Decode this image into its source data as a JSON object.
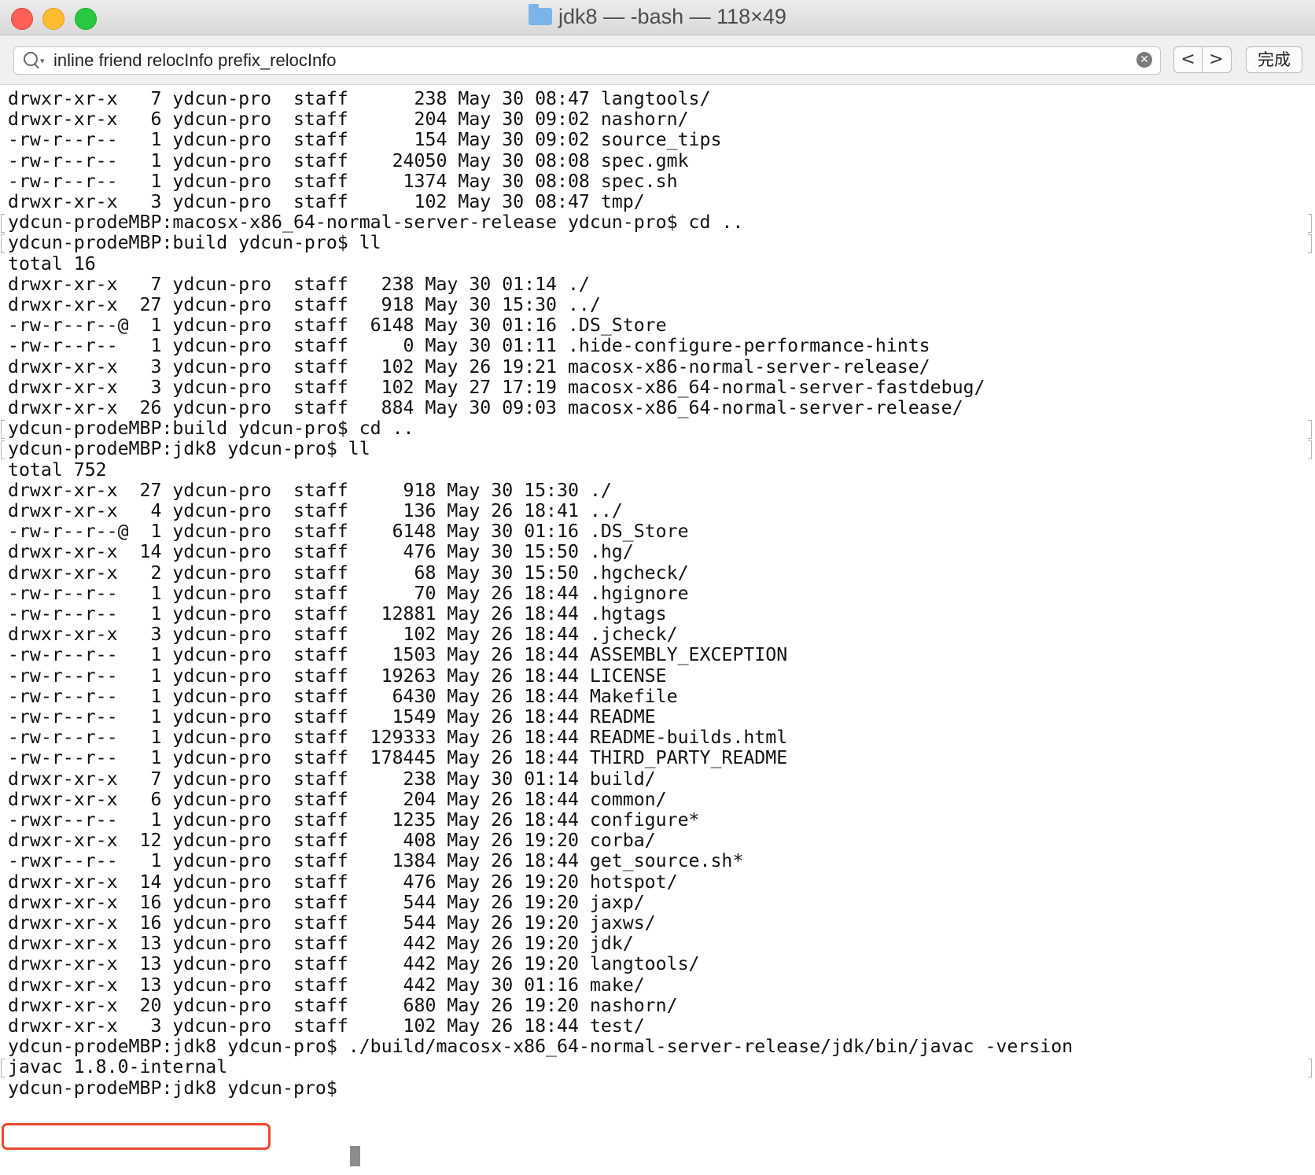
{
  "window": {
    "title": "jdk8 — -bash — 118×49",
    "folder_icon": "folder-icon",
    "buttons": [
      "close",
      "minimize",
      "zoom"
    ]
  },
  "find_bar": {
    "query": "inline friend relocInfo prefix_relocInfo",
    "prev_label": "<",
    "next_label": ">",
    "done_label": "完成"
  },
  "terminal": {
    "lines": [
      "drwxr-xr-x   7 ydcun-pro  staff      238 May 30 08:47 langtools/",
      "drwxr-xr-x   6 ydcun-pro  staff      204 May 30 09:02 nashorn/",
      "-rw-r--r--   1 ydcun-pro  staff      154 May 30 09:02 source_tips",
      "-rw-r--r--   1 ydcun-pro  staff    24050 May 30 08:08 spec.gmk",
      "-rw-r--r--   1 ydcun-pro  staff     1374 May 30 08:08 spec.sh",
      "drwxr-xr-x   3 ydcun-pro  staff      102 May 30 08:47 tmp/",
      "ydcun-prodeMBP:macosx-x86_64-normal-server-release ydcun-pro$ cd ..",
      "ydcun-prodeMBP:build ydcun-pro$ ll",
      "total 16",
      "drwxr-xr-x   7 ydcun-pro  staff   238 May 30 01:14 ./",
      "drwxr-xr-x  27 ydcun-pro  staff   918 May 30 15:30 ../",
      "-rw-r--r--@  1 ydcun-pro  staff  6148 May 30 01:16 .DS_Store",
      "-rw-r--r--   1 ydcun-pro  staff     0 May 30 01:11 .hide-configure-performance-hints",
      "drwxr-xr-x   3 ydcun-pro  staff   102 May 26 19:21 macosx-x86-normal-server-release/",
      "drwxr-xr-x   3 ydcun-pro  staff   102 May 27 17:19 macosx-x86_64-normal-server-fastdebug/",
      "drwxr-xr-x  26 ydcun-pro  staff   884 May 30 09:03 macosx-x86_64-normal-server-release/",
      "ydcun-prodeMBP:build ydcun-pro$ cd ..",
      "ydcun-prodeMBP:jdk8 ydcun-pro$ ll",
      "total 752",
      "drwxr-xr-x  27 ydcun-pro  staff     918 May 30 15:30 ./",
      "drwxr-xr-x   4 ydcun-pro  staff     136 May 26 18:41 ../",
      "-rw-r--r--@  1 ydcun-pro  staff    6148 May 30 01:16 .DS_Store",
      "drwxr-xr-x  14 ydcun-pro  staff     476 May 30 15:50 .hg/",
      "drwxr-xr-x   2 ydcun-pro  staff      68 May 30 15:50 .hgcheck/",
      "-rw-r--r--   1 ydcun-pro  staff      70 May 26 18:44 .hgignore",
      "-rw-r--r--   1 ydcun-pro  staff   12881 May 26 18:44 .hgtags",
      "drwxr-xr-x   3 ydcun-pro  staff     102 May 26 18:44 .jcheck/",
      "-rw-r--r--   1 ydcun-pro  staff    1503 May 26 18:44 ASSEMBLY_EXCEPTION",
      "-rw-r--r--   1 ydcun-pro  staff   19263 May 26 18:44 LICENSE",
      "-rw-r--r--   1 ydcun-pro  staff    6430 May 26 18:44 Makefile",
      "-rw-r--r--   1 ydcun-pro  staff    1549 May 26 18:44 README",
      "-rw-r--r--   1 ydcun-pro  staff  129333 May 26 18:44 README-builds.html",
      "-rw-r--r--   1 ydcun-pro  staff  178445 May 26 18:44 THIRD_PARTY_README",
      "drwxr-xr-x   7 ydcun-pro  staff     238 May 30 01:14 build/",
      "drwxr-xr-x   6 ydcun-pro  staff     204 May 26 18:44 common/",
      "-rwxr--r--   1 ydcun-pro  staff    1235 May 26 18:44 configure*",
      "drwxr-xr-x  12 ydcun-pro  staff     408 May 26 19:20 corba/",
      "-rwxr--r--   1 ydcun-pro  staff    1384 May 26 18:44 get_source.sh*",
      "drwxr-xr-x  14 ydcun-pro  staff     476 May 26 19:20 hotspot/",
      "drwxr-xr-x  16 ydcun-pro  staff     544 May 26 19:20 jaxp/",
      "drwxr-xr-x  16 ydcun-pro  staff     544 May 26 19:20 jaxws/",
      "drwxr-xr-x  13 ydcun-pro  staff     442 May 26 19:20 jdk/",
      "drwxr-xr-x  13 ydcun-pro  staff     442 May 26 19:20 langtools/",
      "drwxr-xr-x  13 ydcun-pro  staff     442 May 30 01:16 make/",
      "drwxr-xr-x  20 ydcun-pro  staff     680 May 26 19:20 nashorn/",
      "drwxr-xr-x   3 ydcun-pro  staff     102 May 26 18:44 test/",
      "ydcun-prodeMBP:jdk8 ydcun-pro$ ./build/macosx-x86_64-normal-server-release/jdk/bin/javac -version",
      "javac 1.8.0-internal",
      "ydcun-prodeMBP:jdk8 ydcun-pro$ "
    ],
    "highlight_color": "#e84a2f"
  }
}
